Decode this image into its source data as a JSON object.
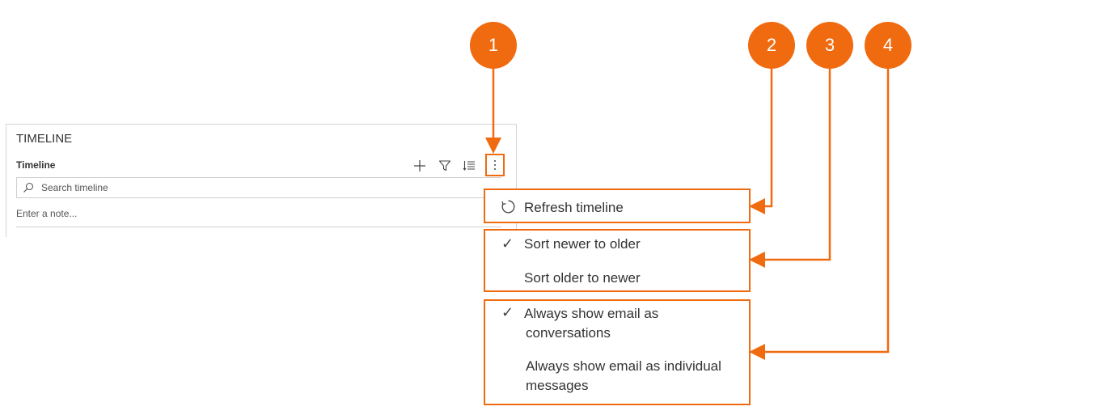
{
  "timeline": {
    "header": "TIMELINE",
    "title": "Timeline",
    "toolbar": {
      "add_icon": "plus-icon",
      "filter_icon": "filter-icon",
      "sort_icon": "sort-list-icon",
      "more_icon": "more-vertical-icon"
    },
    "search": {
      "placeholder": "Search timeline",
      "icon": "search-icon"
    },
    "note": {
      "placeholder": "Enter a note..."
    }
  },
  "menu": {
    "refresh": {
      "label": "Refresh timeline",
      "icon": "refresh-icon"
    },
    "sort_newer": {
      "label": "Sort newer to older",
      "checked": true
    },
    "sort_older": {
      "label": "Sort older to newer",
      "checked": false
    },
    "email_conversation": {
      "line1": "Always show email as",
      "line2": "conversations",
      "checked": true
    },
    "email_individual": {
      "line1": "Always show email as individual",
      "line2": "messages",
      "checked": false
    }
  },
  "callouts": {
    "badge1": "1",
    "badge2": "2",
    "badge3": "3",
    "badge4": "4"
  },
  "colors": {
    "accent": "#f06a10",
    "border": "#d4d4d4",
    "text": "#333333"
  }
}
